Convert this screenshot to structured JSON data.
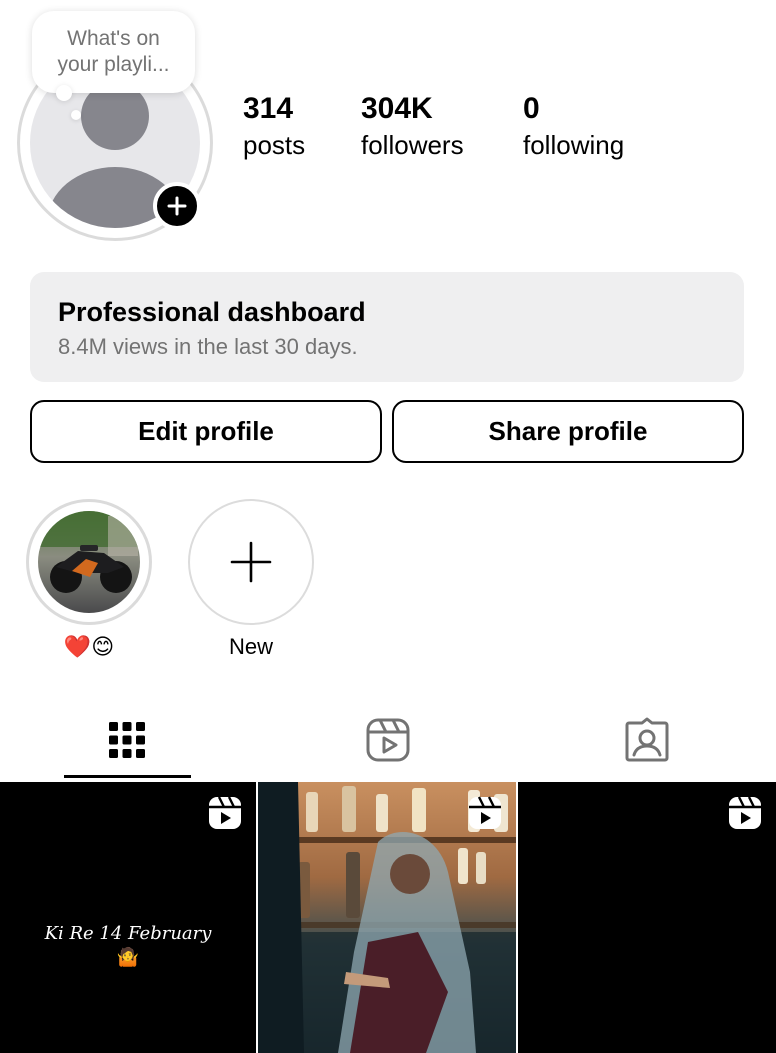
{
  "profile": {
    "note": "What's on\nyour playli...",
    "stats": [
      {
        "value": "314",
        "label": "posts"
      },
      {
        "value": "304K",
        "label": "followers"
      },
      {
        "value": "0",
        "label": "following"
      }
    ]
  },
  "dashboard": {
    "title": "Professional dashboard",
    "subtitle": "8.4M views in the last 30 days."
  },
  "buttons": {
    "edit": "Edit profile",
    "share": "Share profile"
  },
  "highlights": [
    {
      "label": "❤️😊"
    },
    {
      "label": "New"
    }
  ],
  "tabs": [
    "posts-grid-icon",
    "reels-icon",
    "tagged-icon"
  ],
  "grid": [
    {
      "caption": "Ki Re 14 February",
      "caption_emoji": "🤷",
      "type": "reel"
    },
    {
      "type": "reel"
    },
    {
      "type": "reel"
    }
  ]
}
